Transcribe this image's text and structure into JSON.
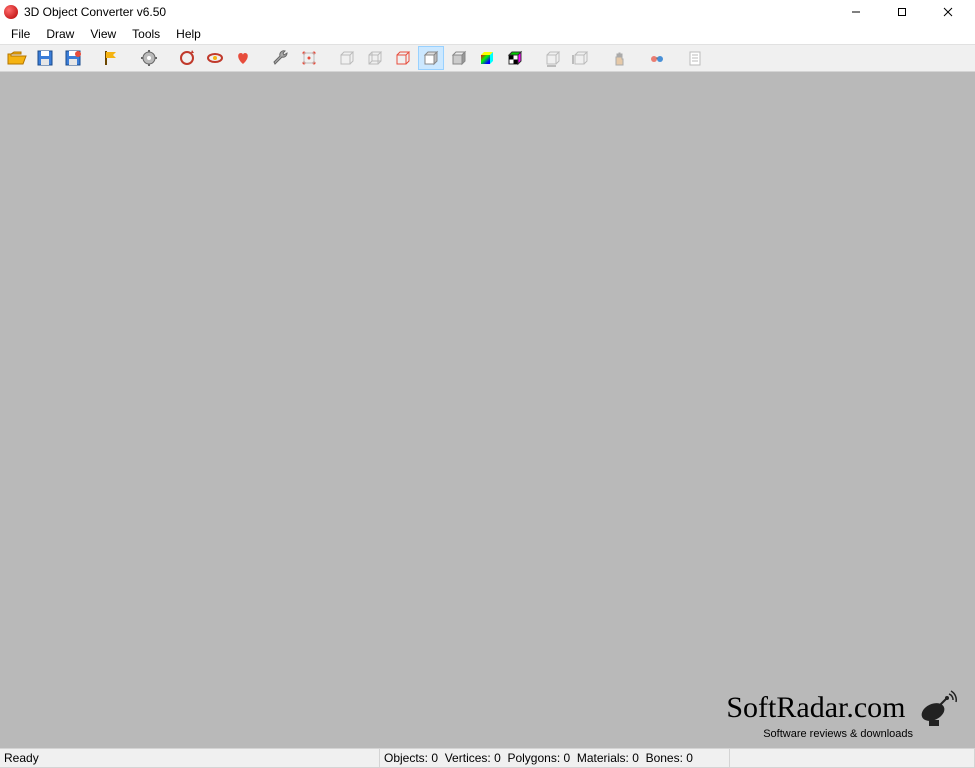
{
  "window": {
    "title": "3D Object Converter v6.50"
  },
  "menu": {
    "items": [
      "File",
      "Draw",
      "View",
      "Tools",
      "Help"
    ]
  },
  "toolbar": {
    "icons": [
      "folder-open-icon",
      "save-icon",
      "save-as-icon",
      "",
      "flag-icon",
      "",
      "gear-icon",
      "",
      "rotate-axis-icon",
      "rotate-ring-icon",
      "rotate-heart-icon",
      "",
      "wrench-icon",
      "points-icon",
      "",
      "cube-wire1-icon",
      "cube-wire2-icon",
      "cube-wire-red-icon",
      "cube-solid-icon",
      "cube-shaded-icon",
      "cube-color-icon",
      "cube-checker-icon",
      "",
      "cube-measure1-icon",
      "cube-measure2-icon",
      "",
      "hand-icon",
      "",
      "glasses-icon",
      "",
      "list-icon"
    ],
    "selected_index": 18
  },
  "status": {
    "ready": "Ready",
    "stats": {
      "objects_label": "Objects:",
      "objects": 0,
      "vertices_label": "Vertices:",
      "vertices": 0,
      "polygons_label": "Polygons:",
      "polygons": 0,
      "materials_label": "Materials:",
      "materials": 0,
      "bones_label": "Bones:",
      "bones": 0
    }
  },
  "watermark": {
    "main": "SoftRadar.com",
    "sub": "Software reviews & downloads"
  }
}
